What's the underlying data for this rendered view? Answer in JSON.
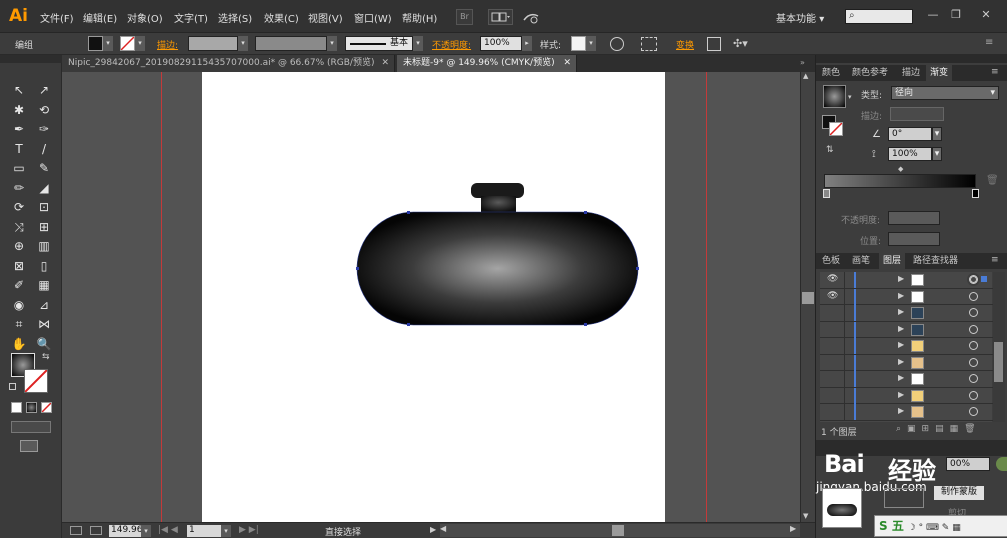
{
  "app": {
    "logo": "Ai"
  },
  "menu": {
    "items": [
      "文件(F)",
      "编辑(E)",
      "对象(O)",
      "文字(T)",
      "选择(S)",
      "效果(C)",
      "视图(V)",
      "窗口(W)",
      "帮助(H)"
    ],
    "br_label": "Br",
    "workspace": "基本功能",
    "workspace_arrow": "▾",
    "search_icon": "⌕",
    "win_min": "—",
    "win_max": "❐",
    "win_close": "✕"
  },
  "control": {
    "selection_label": "编组",
    "stroke_link": "描边:",
    "stroke_style_label": "基本",
    "opacity_link": "不透明度:",
    "opacity_value": "100%",
    "style_label": "样式:",
    "transform_link": "变换",
    "dropdown_arrow": "▾",
    "arrow_right": "▸"
  },
  "tabs": [
    {
      "label": "Nipic_29842067_20190829115435707000.ai* @ 66.67% (RGB/预览)",
      "close": "✕"
    },
    {
      "label": "未标题-9* @ 149.96% (CMYK/预览)",
      "close": "✕"
    }
  ],
  "tools": [
    [
      "↖",
      "↗"
    ],
    [
      "✱",
      "⟲"
    ],
    [
      "✒",
      "✑"
    ],
    [
      "T",
      "/"
    ],
    [
      "▭",
      "✎"
    ],
    [
      "✏",
      "◢"
    ],
    [
      "⟳",
      "⊡"
    ],
    [
      "⤨",
      "⊞"
    ],
    [
      "⊕",
      "▥"
    ],
    [
      "⊠",
      "▯"
    ],
    [
      "✐",
      "▦"
    ],
    [
      "◉",
      "⊿"
    ],
    [
      "⌗",
      "⋈"
    ],
    [
      "✋",
      "🔍"
    ]
  ],
  "gradient_panel": {
    "tabs": [
      "颜色",
      "颜色参考",
      "描边",
      "渐变"
    ],
    "type_label": "类型:",
    "type_value": "径向",
    "stroke_label": "描边:",
    "angle_value": "0°",
    "ratio_value": "100%",
    "opacity_label": "不透明度:",
    "location_label": "位置:",
    "trash_icon": "🗑",
    "menu_icon": "≡",
    "colors": {
      "start": "#808080",
      "end": "#000000"
    }
  },
  "layers_panel": {
    "tabs": [
      "色板",
      "画笔",
      "图层",
      "路径查找器"
    ],
    "rows": [
      {
        "visible": true,
        "thumb": "#ffffff",
        "target_selected": true
      },
      {
        "visible": true,
        "thumb": "#ffffff",
        "target_selected": false
      },
      {
        "visible": false,
        "thumb": "#2c4258",
        "target_selected": false
      },
      {
        "visible": false,
        "thumb": "#2c4258",
        "target_selected": false
      },
      {
        "visible": false,
        "thumb": "#f2d07a",
        "target_selected": false
      },
      {
        "visible": false,
        "thumb": "#e5c18b",
        "target_selected": false
      },
      {
        "visible": false,
        "thumb": "#ffffff",
        "target_selected": false
      },
      {
        "visible": false,
        "thumb": "#f2d07a",
        "target_selected": false
      },
      {
        "visible": false,
        "thumb": "#e5c18b",
        "target_selected": false
      }
    ],
    "eye_icon": "👁",
    "arrow": "▶",
    "footer_label": "1 个图层"
  },
  "appearance_panel": {
    "opacity_value": "00%",
    "mask_button": "制作蒙版",
    "cut_label": "剪切",
    "watermark_text": "经验",
    "watermark_url": "jingyan.baidu.com",
    "watermark_prefix": "Bai",
    "ime_label": "S 五"
  },
  "status": {
    "zoom": "149.96",
    "page": "1",
    "tool": "直接选择"
  }
}
